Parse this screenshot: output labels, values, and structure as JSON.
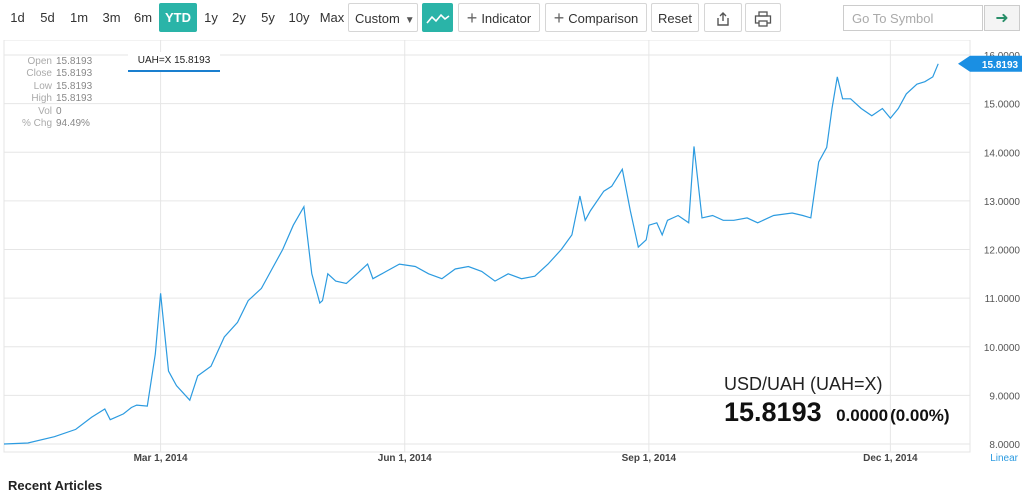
{
  "toolbar": {
    "ranges": [
      "1d",
      "5d",
      "1m",
      "3m",
      "6m",
      "YTD",
      "1y",
      "2y",
      "5y",
      "10y",
      "Max"
    ],
    "active_range": "YTD",
    "custom_label": "Custom",
    "indicator_label": "Indicator",
    "comparison_label": "Comparison",
    "reset_label": "Reset",
    "symbol_placeholder": "Go To Symbol"
  },
  "info_panel": [
    {
      "label": "Open",
      "value": "15.8193"
    },
    {
      "label": "Close",
      "value": "15.8193"
    },
    {
      "label": "Low",
      "value": "15.8193"
    },
    {
      "label": "High",
      "value": "15.8193"
    },
    {
      "label": "Vol",
      "value": "0"
    },
    {
      "label": "% Chg",
      "value": "94.49%"
    }
  ],
  "crosshair_label": "UAH=X 15.8193",
  "quote": {
    "title": "USD/UAH (UAH=X)",
    "price": "15.8193",
    "change": "0.0000",
    "change_pct": "(0.00%)"
  },
  "footer_heading": "Recent Articles",
  "chart_data": {
    "type": "line",
    "symbol": "UAH=X",
    "line_color": "#2c9be0",
    "scale": "Linear",
    "current_value": "15.8193",
    "ylim": [
      7.9,
      16.2
    ],
    "yticks": [
      "16.0000",
      "15.0000",
      "14.0000",
      "13.0000",
      "12.0000",
      "11.0000",
      "10.0000",
      "9.0000",
      "8.0000"
    ],
    "xtick_labels": [
      "Mar 1, 2014",
      "Jun 1, 2014",
      "Sep 1, 2014",
      "Dec 1, 2014"
    ],
    "xticks": [
      "2014-03-01",
      "2014-06-01",
      "2014-09-01",
      "2014-12-01"
    ],
    "x_range": [
      "2014-01-01",
      "2014-12-31"
    ],
    "grid": true,
    "series": [
      {
        "x": [
          "2014-01-01",
          "2014-01-10",
          "2014-01-20",
          "2014-01-28",
          "2014-02-03",
          "2014-02-08",
          "2014-02-10",
          "2014-02-15",
          "2014-02-18",
          "2014-02-20",
          "2014-02-24",
          "2014-02-27",
          "2014-03-01",
          "2014-03-04",
          "2014-03-07",
          "2014-03-12",
          "2014-03-15",
          "2014-03-20",
          "2014-03-25",
          "2014-03-30",
          "2014-04-03",
          "2014-04-08",
          "2014-04-12",
          "2014-04-16",
          "2014-04-20",
          "2014-04-24",
          "2014-04-27",
          "2014-04-30",
          "2014-05-01",
          "2014-05-03",
          "2014-05-06",
          "2014-05-10",
          "2014-05-14",
          "2014-05-18",
          "2014-05-20",
          "2014-05-25",
          "2014-05-30",
          "2014-06-05",
          "2014-06-10",
          "2014-06-15",
          "2014-06-20",
          "2014-06-25",
          "2014-06-30",
          "2014-07-05",
          "2014-07-10",
          "2014-07-15",
          "2014-07-20",
          "2014-07-25",
          "2014-07-30",
          "2014-08-03",
          "2014-08-06",
          "2014-08-08",
          "2014-08-10",
          "2014-08-15",
          "2014-08-18",
          "2014-08-22",
          "2014-08-25",
          "2014-08-28",
          "2014-08-31",
          "2014-09-01",
          "2014-09-04",
          "2014-09-06",
          "2014-09-08",
          "2014-09-12",
          "2014-09-16",
          "2014-09-18",
          "2014-09-21",
          "2014-09-25",
          "2014-09-29",
          "2014-10-03",
          "2014-10-08",
          "2014-10-12",
          "2014-10-18",
          "2014-10-25",
          "2014-10-29",
          "2014-11-01",
          "2014-11-04",
          "2014-11-07",
          "2014-11-09",
          "2014-11-11",
          "2014-11-13",
          "2014-11-16",
          "2014-11-20",
          "2014-11-24",
          "2014-11-28",
          "2014-12-01",
          "2014-12-04",
          "2014-12-07",
          "2014-12-11",
          "2014-12-14",
          "2014-12-17",
          "2014-12-19"
        ],
        "y": [
          8.0,
          8.02,
          8.15,
          8.3,
          8.55,
          8.72,
          8.5,
          8.62,
          8.75,
          8.8,
          8.78,
          9.85,
          11.1,
          9.5,
          9.2,
          8.9,
          9.4,
          9.6,
          10.2,
          10.5,
          10.95,
          11.2,
          11.6,
          12.0,
          12.5,
          12.88,
          11.5,
          10.9,
          10.95,
          11.5,
          11.35,
          11.3,
          11.5,
          11.7,
          11.4,
          11.55,
          11.7,
          11.65,
          11.5,
          11.4,
          11.6,
          11.65,
          11.55,
          11.35,
          11.5,
          11.4,
          11.45,
          11.7,
          12.0,
          12.3,
          13.1,
          12.6,
          12.8,
          13.2,
          13.3,
          13.65,
          12.8,
          12.05,
          12.2,
          12.5,
          12.55,
          12.3,
          12.6,
          12.7,
          12.55,
          14.12,
          12.65,
          12.7,
          12.6,
          12.6,
          12.65,
          12.55,
          12.7,
          12.75,
          12.7,
          12.65,
          13.8,
          14.1,
          14.9,
          15.55,
          15.1,
          15.1,
          14.9,
          14.75,
          14.9,
          14.7,
          14.9,
          15.2,
          15.4,
          15.45,
          15.55,
          15.82
        ]
      }
    ]
  }
}
